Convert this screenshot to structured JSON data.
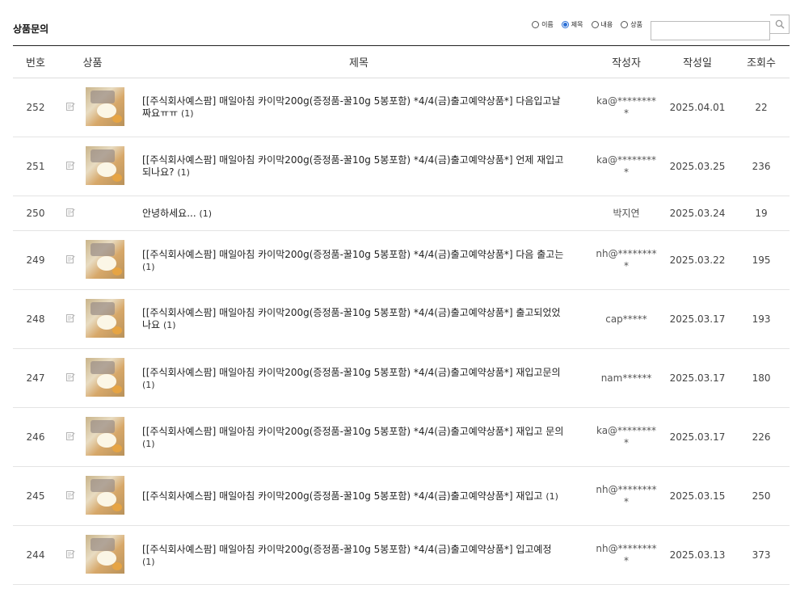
{
  "header": {
    "title": "상품문의",
    "search_options": [
      {
        "label": "이름",
        "checked": false
      },
      {
        "label": "제목",
        "checked": true
      },
      {
        "label": "내용",
        "checked": false
      },
      {
        "label": "상품",
        "checked": false
      }
    ],
    "search_value": "",
    "search_icon": "search-icon"
  },
  "table": {
    "columns": [
      "번호",
      "상품",
      "제목",
      "작성자",
      "작성일",
      "조회수"
    ],
    "rows": [
      {
        "no": "252",
        "thumb": true,
        "title": "[[주식회사예스팜] 매일아침 카이막200g(증정품-꿀10g 5봉포함) *4/4(금)출고예약상품*] 다음입고날짜요ㅠㅠ",
        "comments": "(1)",
        "writer": "ka@*********",
        "date": "2025.04.01",
        "hits": "22"
      },
      {
        "no": "251",
        "thumb": true,
        "title": "[[주식회사예스팜] 매일아침 카이막200g(증정품-꿀10g 5봉포함) *4/4(금)출고예약상품*] 언제 재입고되나요?",
        "comments": "(1)",
        "writer": "ka@*********",
        "date": "2025.03.25",
        "hits": "236"
      },
      {
        "no": "250",
        "thumb": false,
        "title": "안녕하세요...",
        "comments": "(1)",
        "writer": "박지연",
        "date": "2025.03.24",
        "hits": "19"
      },
      {
        "no": "249",
        "thumb": true,
        "title": "[[주식회사예스팜] 매일아침 카이막200g(증정품-꿀10g 5봉포함) *4/4(금)출고예약상품*] 다음 출고는",
        "comments": "(1)",
        "writer": "nh@*********",
        "date": "2025.03.22",
        "hits": "195"
      },
      {
        "no": "248",
        "thumb": true,
        "title": "[[주식회사예스팜] 매일아침 카이막200g(증정품-꿀10g 5봉포함) *4/4(금)출고예약상품*] 출고되었었나요",
        "comments": "(1)",
        "writer": "cap*****",
        "date": "2025.03.17",
        "hits": "193"
      },
      {
        "no": "247",
        "thumb": true,
        "title": "[[주식회사예스팜] 매일아침 카이막200g(증정품-꿀10g 5봉포함) *4/4(금)출고예약상품*] 재입고문의",
        "comments": "(1)",
        "writer": "nam******",
        "date": "2025.03.17",
        "hits": "180"
      },
      {
        "no": "246",
        "thumb": true,
        "title": "[[주식회사예스팜] 매일아침 카이막200g(증정품-꿀10g 5봉포함) *4/4(금)출고예약상품*] 재입고 문의",
        "comments": "(1)",
        "writer": "ka@*********",
        "date": "2025.03.17",
        "hits": "226"
      },
      {
        "no": "245",
        "thumb": true,
        "title": "[[주식회사예스팜] 매일아침 카이막200g(증정품-꿀10g 5봉포함) *4/4(금)출고예약상품*] 재입고",
        "comments": "(1)",
        "writer": "nh@*********",
        "date": "2025.03.15",
        "hits": "250"
      },
      {
        "no": "244",
        "thumb": true,
        "title": "[[주식회사예스팜] 매일아침 카이막200g(증정품-꿀10g 5봉포함) *4/4(금)출고예약상품*] 입고예정",
        "comments": "(1)",
        "writer": "nh@*********",
        "date": "2025.03.13",
        "hits": "373"
      }
    ]
  },
  "icons": {
    "row_icon": "memo-icon",
    "search": "search-icon"
  },
  "colors": {
    "accent": "#2a6fd6",
    "border_strong": "#222222",
    "border_light": "#e4e4e4"
  }
}
